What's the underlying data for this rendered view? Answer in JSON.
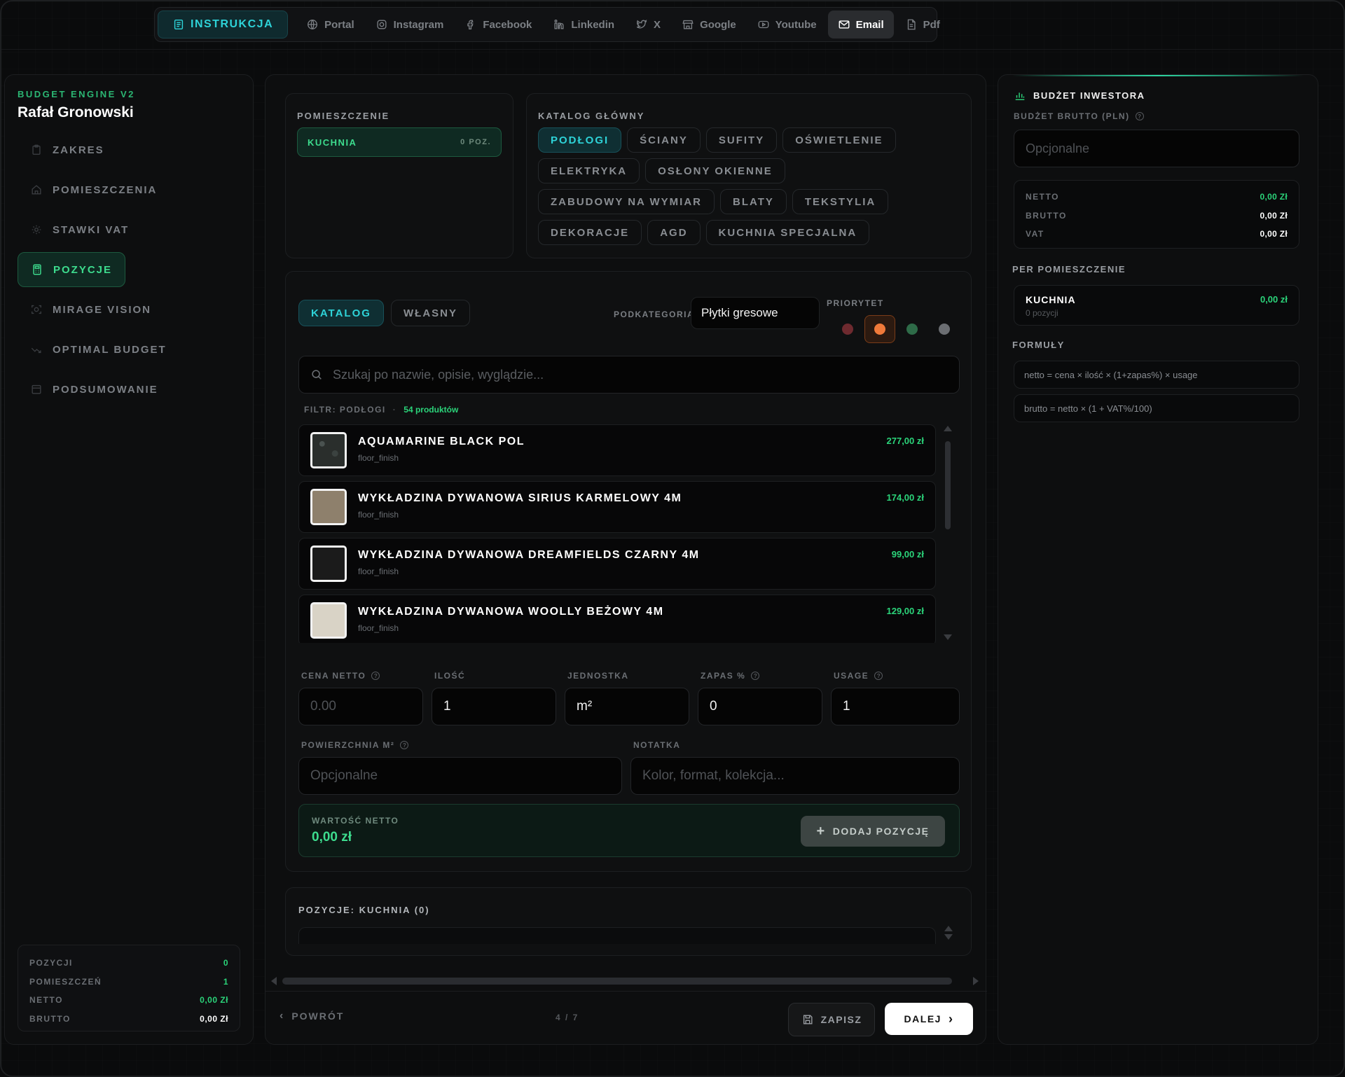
{
  "topnav": {
    "items": [
      {
        "label": "INSTRUKCJA",
        "icon": "book-icon"
      },
      {
        "label": "Portal",
        "icon": "globe-icon"
      },
      {
        "label": "Instagram",
        "icon": "instagram-icon"
      },
      {
        "label": "Facebook",
        "icon": "facebook-icon"
      },
      {
        "label": "Linkedin",
        "icon": "linkedin-icon"
      },
      {
        "label": "X",
        "icon": "twitter-icon"
      },
      {
        "label": "Google",
        "icon": "store-icon"
      },
      {
        "label": "Youtube",
        "icon": "youtube-icon"
      },
      {
        "label": "Email",
        "icon": "mail-icon"
      },
      {
        "label": "Pdf",
        "icon": "file-icon"
      }
    ],
    "active": "Email"
  },
  "sidebar": {
    "app_name": "BUDGET ENGINE V2",
    "user": "Rafał Gronowski",
    "items": [
      {
        "label": "ZAKRES",
        "icon": "clipboard-icon"
      },
      {
        "label": "POMIESZCZENIA",
        "icon": "home-icon"
      },
      {
        "label": "STAWKI VAT",
        "icon": "gear-icon"
      },
      {
        "label": "POZYCJE",
        "icon": "calculator-icon",
        "active": true
      },
      {
        "label": "MIRAGE VISION",
        "icon": "scan-icon"
      },
      {
        "label": "OPTIMAL BUDGET",
        "icon": "trend-icon"
      },
      {
        "label": "PODSUMOWANIE",
        "icon": "report-icon"
      }
    ],
    "stats": [
      {
        "label": "POZYCJI",
        "value": "0"
      },
      {
        "label": "POMIESZCZEŃ",
        "value": "1"
      },
      {
        "label": "NETTO",
        "value": "0,00 Zł"
      },
      {
        "label": "BRUTTO",
        "value": "0,00 Zł"
      }
    ]
  },
  "room": {
    "label": "POMIESZCZENIE",
    "selected": "KUCHNIA",
    "count": "0 POZ."
  },
  "catalog": {
    "label": "KATALOG GŁÓWNY",
    "categories": [
      "PODŁOGI",
      "ŚCIANY",
      "SUFITY",
      "OŚWIETLENIE",
      "ELEKTRYKA",
      "OSŁONY OKIENNE",
      "ZABUDOWY NA WYMIAR",
      "BLATY",
      "TEKSTYLIA",
      "DEKORACJE",
      "AGD",
      "KUCHNIA SPECJALNA"
    ],
    "active": "PODŁOGI"
  },
  "form": {
    "tabs": [
      "KATALOG",
      "WŁASNY"
    ],
    "active_tab": "KATALOG",
    "subcategory_label": "PODKATEGORIA",
    "subcategory_value": "Płytki gresowe",
    "priority_label": "PRIORYTET",
    "priority_colors": [
      "#6e2a2f",
      "#f07a3a",
      "#2e6b48",
      "#6b6e72"
    ],
    "priority_selected": 1,
    "search_placeholder": "Szukaj po nazwie, opisie, wyglądzie...",
    "filter_label": "FILTR: PODŁOGI",
    "filter_sep": "·",
    "filter_count": "54 produktów",
    "products": [
      {
        "name": "AQUAMARINE BLACK POL",
        "category": "floor_finish",
        "price": "277,00 zł",
        "swatch": "#2a2e2c"
      },
      {
        "name": "WYKŁADZINA DYWANOWA SIRIUS KARMELOWY 4M",
        "category": "floor_finish",
        "price": "174,00 zł",
        "swatch": "#8e806c"
      },
      {
        "name": "WYKŁADZINA DYWANOWA DREAMFIELDS CZARNY 4M",
        "category": "floor_finish",
        "price": "99,00 zł",
        "swatch": "#1b1b1b"
      },
      {
        "name": "WYKŁADZINA DYWANOWA WOOLLY BEŻOWY 4M",
        "category": "floor_finish",
        "price": "129,00 zł",
        "swatch": "#d9d3c6"
      }
    ],
    "fields": {
      "price_label": "CENA NETTO",
      "price_placeholder": "0.00",
      "qty_label": "ILOŚĆ",
      "qty_value": "1",
      "unit_label": "JEDNOSTKA",
      "unit_value": "m²",
      "reserve_label": "ZAPAS %",
      "reserve_value": "0",
      "usage_label": "USAGE",
      "usage_value": "1",
      "area_label": "POWIERZCHNIA M²",
      "area_placeholder": "Opcjonalne",
      "note_label": "NOTATKA",
      "note_placeholder": "Kolor, format, kolekcja..."
    },
    "value_label": "WARTOŚĆ NETTO",
    "value": "0,00 zł",
    "add_button": "DODAJ POZYCJĘ"
  },
  "positions": {
    "title": "POZYCJE: KUCHNIA (0)"
  },
  "footer": {
    "back": "POWRÓT",
    "pager": "4 / 7",
    "save": "ZAPISZ",
    "next": "DALEJ"
  },
  "budget": {
    "title": "BUDŻET INWESTORA",
    "gross_label": "BUDŻET BRUTTO (PLN)",
    "gross_placeholder": "Opcjonalne",
    "rows": [
      {
        "label": "NETTO",
        "value": "0,00 Zł"
      },
      {
        "label": "BRUTTO",
        "value": "0,00 Zł"
      },
      {
        "label": "VAT",
        "value": "0,00 Zł"
      }
    ],
    "per_room_label": "PER POMIESZCZENIE",
    "room_name": "KUCHNIA",
    "room_sub": "0 pozycji",
    "room_value": "0,00 zł",
    "formulas_label": "FORMUŁY",
    "formulas": [
      "netto = cena × ilość × (1+zapas%) × usage",
      "brutto = netto × (1 + VAT%/100)"
    ]
  },
  "colors": {
    "accent_cyan": "#2ed3d8",
    "accent_green": "#3ddc8e",
    "price_green": "#2bd47a"
  }
}
